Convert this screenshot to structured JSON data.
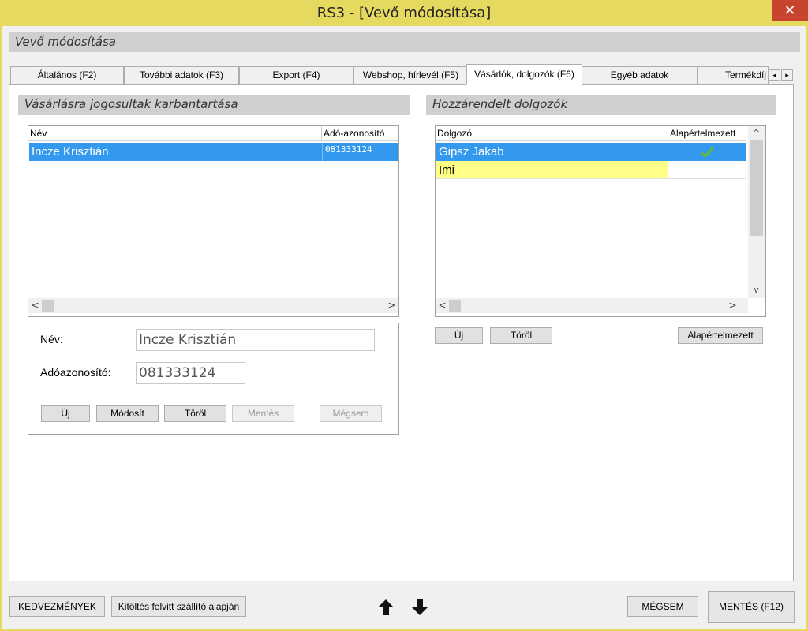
{
  "window": {
    "title": "RS3 - [Vevő módosítása]",
    "close_glyph": "✕"
  },
  "header": {
    "title": "Vevő módosítása"
  },
  "tabs": [
    {
      "label": "Általános (F2)",
      "active": false
    },
    {
      "label": "További adatok (F3)",
      "active": false
    },
    {
      "label": "Export (F4)",
      "active": false
    },
    {
      "label": "Webshop, hírlevél (F5)",
      "active": false
    },
    {
      "label": "Vásárlók, dolgozók (F6)",
      "active": true
    },
    {
      "label": "Egyéb adatok",
      "active": false
    },
    {
      "label": "Termékdíj",
      "active": false
    }
  ],
  "tab_scroll": {
    "left": "◂",
    "right": "▸"
  },
  "left_panel": {
    "title": "Vásárlásra jogosultak karbantartása",
    "grid": {
      "columns": [
        "Név",
        "Adó-azonosító"
      ],
      "rows": [
        {
          "name": "Incze Krisztián",
          "tax_id": "081333124",
          "selected": true
        }
      ]
    },
    "form": {
      "name_label": "Név:",
      "name_value": "Incze Krisztián",
      "tax_label": "Adóazonosító:",
      "tax_value": "081333124"
    },
    "buttons": {
      "new": "Új",
      "modify": "Módosít",
      "delete": "Töröl",
      "save": "Mentés",
      "cancel": "Mégsem"
    }
  },
  "right_panel": {
    "title": "Hozzárendelt dolgozók",
    "grid": {
      "columns": [
        "Dolgozó",
        "Alapértelmezett"
      ],
      "rows": [
        {
          "name": "Gipsz Jakab",
          "default": true,
          "selected": true
        },
        {
          "name": "Imi",
          "default": false,
          "highlight": "#ffff88"
        }
      ]
    },
    "buttons": {
      "new": "Új",
      "delete": "Töröl",
      "default": "Alapértelmezett"
    }
  },
  "scroll_glyphs": {
    "left": "<",
    "right": ">",
    "up": "^",
    "down": "v"
  },
  "footer": {
    "discounts": "KEDVEZMÉNYEK",
    "fill_from_carrier": "Kitöltés felvitt szállító alapján",
    "cancel": "MÉGSEM",
    "save": "MENTÉS (F12)"
  },
  "colors": {
    "titlebar": "#e6d960",
    "selection": "#3399ee",
    "close": "#c7442f",
    "check": "#66bb33"
  }
}
